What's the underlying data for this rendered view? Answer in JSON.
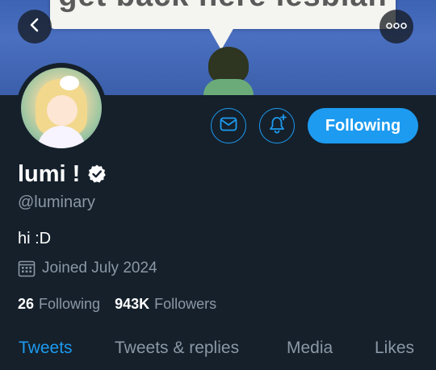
{
  "banner": {
    "text": "get back here lesbian"
  },
  "profile": {
    "name": "lumi !",
    "handle": "@luminary",
    "bio": "hi :D",
    "joined": "Joined July 2024",
    "following_count": "26",
    "following_label": "Following",
    "followers_count": "943K",
    "followers_label": "Followers"
  },
  "actions": {
    "follow_label": "Following",
    "mail_icon": "envelope-icon",
    "bell_icon": "bell-plus-icon"
  },
  "nav": {
    "back_icon": "chevron-left-icon",
    "more_icon": "more-dots-icon"
  },
  "tabs": [
    {
      "label": "Tweets",
      "active": true
    },
    {
      "label": "Tweets & replies",
      "active": false
    },
    {
      "label": "Media",
      "active": false
    },
    {
      "label": "Likes",
      "active": false
    }
  ],
  "colors": {
    "accent": "#1d9bf0",
    "background": "#15202b",
    "secondary_text": "#8b98a5"
  }
}
